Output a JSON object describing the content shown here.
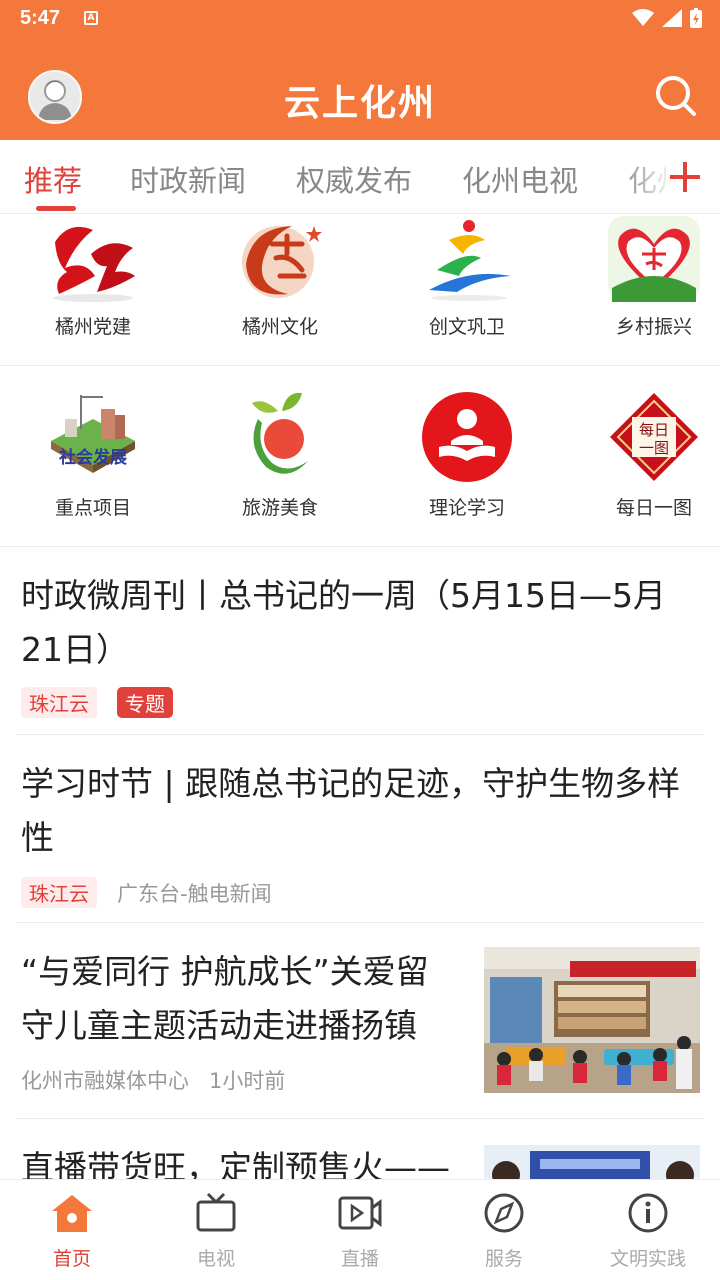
{
  "status_bar": {
    "time": "5:47",
    "notification_glyph": "A"
  },
  "header": {
    "title": "云上化州",
    "avatar_icon": "user-avatar-icon",
    "search_icon": "search-icon"
  },
  "tabs": [
    {
      "label": "推荐",
      "active": true
    },
    {
      "label": "时政新闻",
      "active": false
    },
    {
      "label": "权威发布",
      "active": false
    },
    {
      "label": "化州电视",
      "active": false
    },
    {
      "label": "化州",
      "active": false
    }
  ],
  "grid_row1": [
    {
      "label": "橘州党建",
      "icon": "party-building-icon"
    },
    {
      "label": "橘州文化",
      "icon": "culture-icon"
    },
    {
      "label": "创文巩卫",
      "icon": "civilization-icon"
    },
    {
      "label": "乡村振兴",
      "icon": "rural-revitalization-icon"
    }
  ],
  "grid_row2": [
    {
      "label": "重点项目",
      "icon": "key-projects-icon",
      "badge": "社会发展"
    },
    {
      "label": "旅游美食",
      "icon": "travel-food-icon"
    },
    {
      "label": "理论学习",
      "icon": "theory-study-icon"
    },
    {
      "label": "每日一图",
      "icon": "daily-picture-icon",
      "badge_top": "每日",
      "badge_bottom": "一图"
    }
  ],
  "news": [
    {
      "title": "时政微周刊丨总书记的一周（5月15日—5月21日）",
      "source_tag": "珠江云",
      "topic_tag": "专题"
    },
    {
      "title": "学习时节 | 跟随总书记的足迹，守护生物多样性",
      "source_tag": "珠江云",
      "source": "广东台-触电新闻"
    },
    {
      "title": "“与爱同行  护航成长”关爱留守儿童主题活动走进播扬镇",
      "source": "化州市融媒体中心",
      "time": "1小时前"
    },
    {
      "title": "直播带货旺，定制预售火——"
    }
  ],
  "bottom_nav": [
    {
      "label": "首页",
      "icon": "home-icon",
      "active": true
    },
    {
      "label": "电视",
      "icon": "tv-icon",
      "active": false
    },
    {
      "label": "直播",
      "icon": "live-video-icon",
      "active": false
    },
    {
      "label": "服务",
      "icon": "compass-icon",
      "active": false
    },
    {
      "label": "文明实践",
      "icon": "info-icon",
      "active": false
    }
  ],
  "colors": {
    "brand_orange": "#f4783c",
    "accent_red": "#e0413a"
  }
}
